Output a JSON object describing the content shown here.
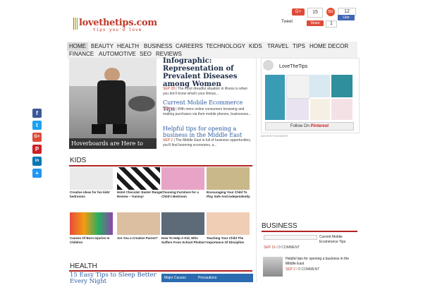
{
  "logo": {
    "text": "lovethetips.com",
    "tagline": "tips you'd love"
  },
  "social_top": {
    "gplus_label": "G+",
    "gplus_count": "15",
    "stumble_label": "su",
    "fb_count": "12",
    "fb_like_label": "Like",
    "tweet_label": "Tweet",
    "share_label": "Share",
    "share_count": "1"
  },
  "nav": [
    "HOME",
    "BEAUTY",
    "HEALTH",
    "BUSINESS",
    "CAREERS",
    "TECHNOLOGY",
    "KIDS",
    "TRAVEL",
    "TIPS",
    "HOME DECOR",
    "FINANCE",
    "AUTOMOTIVE",
    "SEO",
    "REVIEWS"
  ],
  "feature": {
    "caption": "Hoverboards are Here to Stay"
  },
  "articles": [
    {
      "title": "Infographic: Representation of Prevalent Diseases among Women",
      "date": "SEP 28",
      "excerpt": "The most dreadful situation in illness is when you don't know what's your illness..."
    },
    {
      "title": "Current Mobile Ecommerce Tips",
      "date": "SEP 16",
      "excerpt": "With more online consumers browsing and making purchases via their mobile phones, businesses..."
    },
    {
      "title": "Helpful tips for opening a business in the Middle East",
      "date": "SEP 2",
      "excerpt": "The Middle East is full of business opportunities, you'll find booming economies, a..."
    }
  ],
  "widget": {
    "name": "LoveTheTips",
    "follow_label": "Follow On",
    "follow_brand": "Pinterest",
    "advert": "ADVERTISEMENT"
  },
  "share_icons": [
    "facebook-icon",
    "twitter-icon",
    "googleplus-icon",
    "pinterest-icon",
    "linkedin-icon",
    "share-icon"
  ],
  "share_glyphs": [
    "f",
    "t",
    "G+",
    "P",
    "in",
    "+"
  ],
  "kids": {
    "title": "KIDS",
    "items": [
      "Creative ideas for fun kids' bedrooms",
      "Hotel Chocolat: Easter Range Review – Yummy!",
      "Choosing Furniture for a Child's Bedroom",
      "Encouraging Your Child To Play Safe And Independently",
      "Causes Of Burn Injuries In Children",
      "Are You a Creative Parent?",
      "How To Help A Kid, Who Suffers From School Phobia?",
      "Teaching Your Child The Importance Of Discipline"
    ]
  },
  "business": {
    "title": "BUSINESS",
    "item1_title": "Current Mobile Ecommerce Tips",
    "item1_date": "SEP 16",
    "item1_comments": "0 COMMENT",
    "item2_title": "Helpful tips for opening a business in the Middle East",
    "item2_date": "SEP 2",
    "item2_comments": "0 COMMENT"
  },
  "health": {
    "title": "HEALTH",
    "article_title": "15 Easy Tips to Sleep Better Every Night",
    "img_label1": "Major Causes",
    "img_label2": "Precautions"
  },
  "colors": {
    "accent": "#b22222",
    "link": "#2c5aa0",
    "nav_bg": "#f1f1f1"
  }
}
